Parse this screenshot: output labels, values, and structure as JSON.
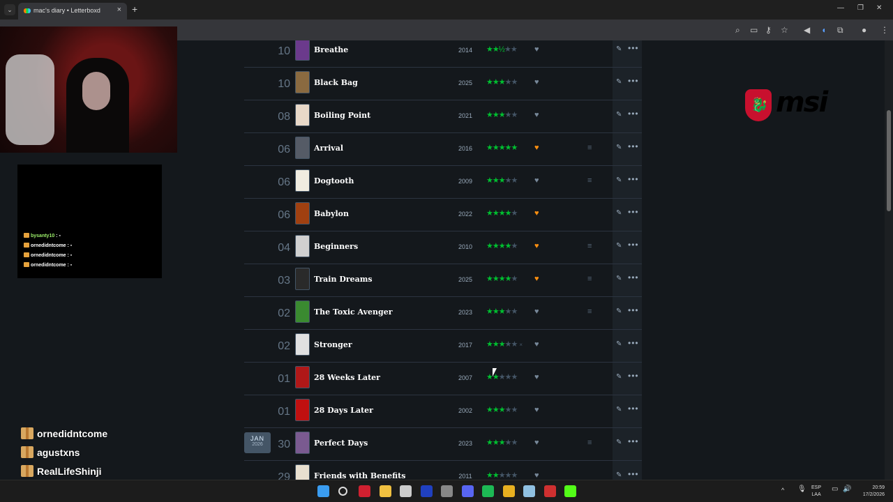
{
  "browser": {
    "tab_title": "mac's diary • Letterboxd",
    "close_glyph": "×",
    "new_tab_glyph": "+",
    "toolbar_icons": [
      "zoom-icon",
      "cast-icon",
      "key-icon",
      "bookmark-star-icon",
      "volume-icon",
      "extension-icon",
      "puzzle-icon",
      "profile-icon",
      "menu-icon"
    ]
  },
  "diary": {
    "entries": [
      {
        "day": "10",
        "title": "Breathe",
        "year": "2014",
        "rating": 2.5,
        "liked": false,
        "review": false,
        "poster_color": "#6b3a8c"
      },
      {
        "day": "10",
        "title": "Black Bag",
        "year": "2025",
        "rating": 3,
        "liked": false,
        "review": false,
        "poster_color": "#8a6a40"
      },
      {
        "day": "08",
        "title": "Boiling Point",
        "year": "2021",
        "rating": 3,
        "liked": false,
        "review": false,
        "poster_color": "#e8d8c8"
      },
      {
        "day": "06",
        "title": "Arrival",
        "year": "2016",
        "rating": 5,
        "liked": true,
        "review": true,
        "poster_color": "#555b66"
      },
      {
        "day": "06",
        "title": "Dogtooth",
        "year": "2009",
        "rating": 3,
        "liked": false,
        "review": true,
        "poster_color": "#f0ece0"
      },
      {
        "day": "06",
        "title": "Babylon",
        "year": "2022",
        "rating": 4,
        "liked": true,
        "review": false,
        "poster_color": "#a04010"
      },
      {
        "day": "04",
        "title": "Beginners",
        "year": "2010",
        "rating": 4,
        "liked": true,
        "review": true,
        "poster_color": "#d0d0d0"
      },
      {
        "day": "03",
        "title": "Train Dreams",
        "year": "2025",
        "rating": 4,
        "liked": true,
        "review": true,
        "poster_color": "#2a2a2a"
      },
      {
        "day": "02",
        "title": "The Toxic Avenger",
        "year": "2023",
        "rating": 3,
        "liked": false,
        "review": true,
        "poster_color": "#3a8a30"
      },
      {
        "day": "02",
        "title": "Stronger",
        "year": "2017",
        "rating": 3,
        "liked": false,
        "review": false,
        "poster_color": "#e0e0e0",
        "rewatch_mark": "×"
      },
      {
        "day": "01",
        "title": "28 Weeks Later",
        "year": "2007",
        "rating": 2,
        "liked": false,
        "review": false,
        "poster_color": "#b01818"
      },
      {
        "day": "01",
        "title": "28 Days Later",
        "year": "2002",
        "rating": 3,
        "liked": false,
        "review": false,
        "poster_color": "#c01010"
      },
      {
        "day": "30",
        "title": "Perfect Days",
        "year": "2023",
        "rating": 3,
        "liked": false,
        "review": true,
        "poster_color": "#7a5a90",
        "month": "JAN",
        "month_year": "2026"
      },
      {
        "day": "29",
        "title": "Friends with Benefits",
        "year": "2011",
        "rating": 2,
        "liked": false,
        "review": false,
        "poster_color": "#e8e0d0"
      }
    ]
  },
  "stream": {
    "chat": [
      {
        "user": "bysanty10",
        "message": ":"
      },
      {
        "user": "ornedidntcome",
        "message": ":"
      },
      {
        "user": "ornedidntcome",
        "message": ":"
      },
      {
        "user": "ornedidntcome",
        "message": ":"
      }
    ],
    "recent_subs": [
      "ornedidntcome",
      "agustxns",
      "RealLifeShinji"
    ]
  },
  "logo": {
    "text": "msi",
    "color": "#c8102e"
  },
  "taskbar": {
    "apps": [
      {
        "name": "windows-start-icon",
        "color": "#3a9cf0"
      },
      {
        "name": "search-icon",
        "color": "#dddddd"
      },
      {
        "name": "app-red-icon",
        "color": "#d02030"
      },
      {
        "name": "file-explorer-icon",
        "color": "#f0c040"
      },
      {
        "name": "store-icon",
        "color": "#cccccc"
      },
      {
        "name": "valorant-icon",
        "color": "#2040c0"
      },
      {
        "name": "obs-icon",
        "color": "#888888"
      },
      {
        "name": "discord-icon",
        "color": "#5865f2"
      },
      {
        "name": "spotify-icon",
        "color": "#1db954"
      },
      {
        "name": "chrome-icon",
        "color": "#e8b020"
      },
      {
        "name": "app-swirl-icon",
        "color": "#90c0e0"
      },
      {
        "name": "app-box-icon",
        "color": "#d03030"
      },
      {
        "name": "kick-icon",
        "color": "#53fc18"
      }
    ],
    "lang": "ESP",
    "layout": "LAA",
    "time": "20:59",
    "date": "17/2/2026"
  }
}
